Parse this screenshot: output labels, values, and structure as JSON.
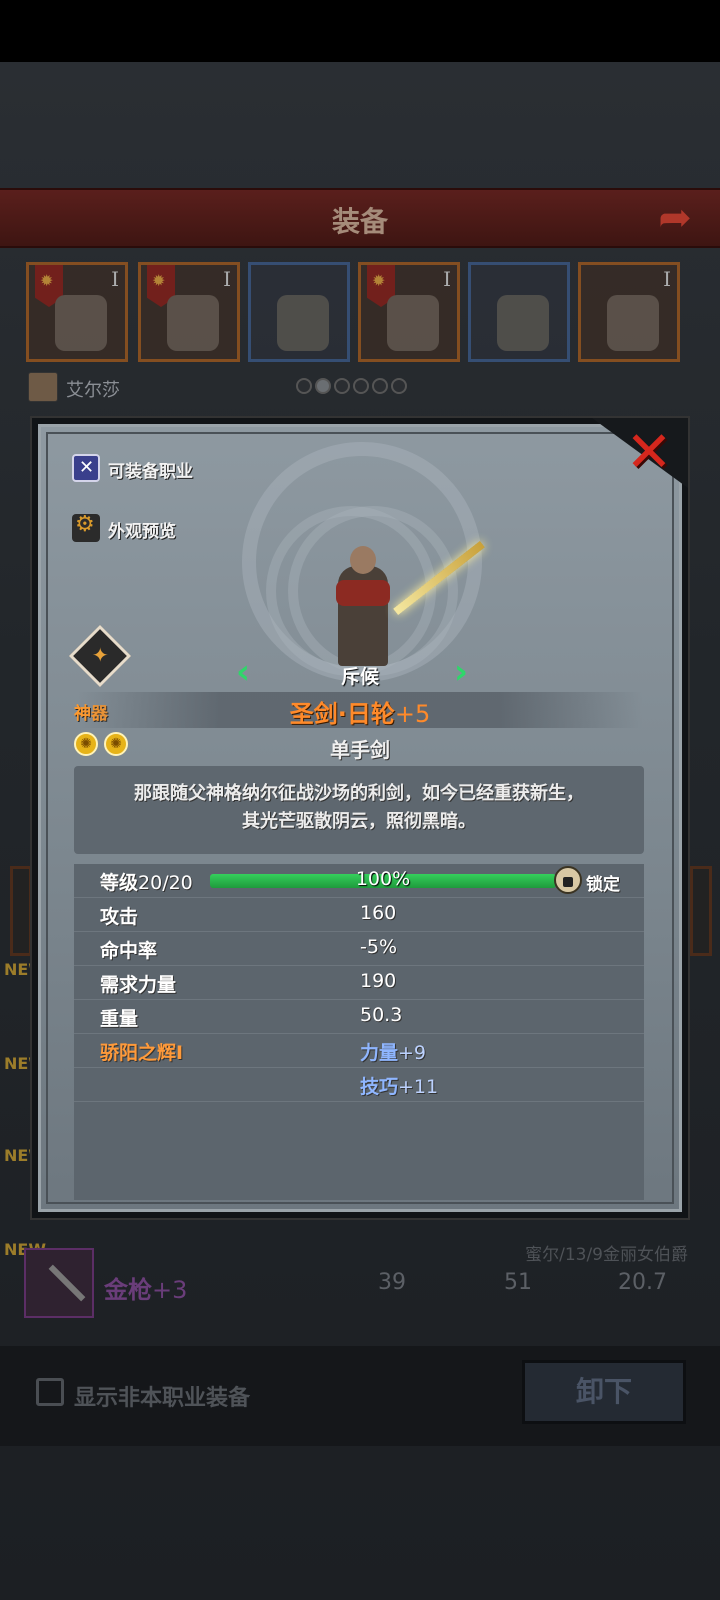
{
  "background": {
    "header_title": "装备",
    "slots": [
      {
        "name": "shoulder",
        "tier": "I",
        "rarity": "orange"
      },
      {
        "name": "cape",
        "tier": "I",
        "rarity": "orange"
      },
      {
        "name": "helmet",
        "tier": "",
        "rarity": "blue"
      },
      {
        "name": "armor",
        "tier": "I",
        "rarity": "orange"
      },
      {
        "name": "boots",
        "tier": "",
        "rarity": "blue"
      },
      {
        "name": "book",
        "tier": "I",
        "rarity": "orange"
      }
    ],
    "character_name": "艾尔莎",
    "list": {
      "new_tag": "NEW",
      "item_name": "金枪",
      "item_plus": "+3",
      "values": [
        "39",
        "51",
        "20.7"
      ],
      "owner": "蜜尔/13/9金丽女伯爵"
    },
    "show_other_class_label": "显示非本职业装备",
    "unequip_label": "卸下"
  },
  "modal": {
    "equip_classes_label": "可装备职业",
    "appearance_preview_label": "外观预览",
    "class_name": "斥候",
    "artifact_label": "神器",
    "item_name": "圣剑·日轮",
    "item_plus": "+5",
    "item_type": "单手剑",
    "description_line1": "那跟随父神格纳尔征战沙场的利剑，如今已经重获新生，",
    "description_line2": "其光芒驱散阴云，照彻黑暗。",
    "level": {
      "label": "等级",
      "value": "20/20",
      "progress_text": "100%",
      "progress": 1.0,
      "lock_label": "锁定"
    },
    "stats": [
      {
        "label": "攻击",
        "value": "160"
      },
      {
        "label": "命中率",
        "value": "-5%"
      },
      {
        "label": "需求力量",
        "value": "190"
      },
      {
        "label": "重量",
        "value": "50.3"
      }
    ],
    "enchant": {
      "name": "骄阳之辉I",
      "bonus1_stat": "力量",
      "bonus1_amt": "+9",
      "bonus2_stat": "技巧",
      "bonus2_amt": "+11"
    }
  }
}
